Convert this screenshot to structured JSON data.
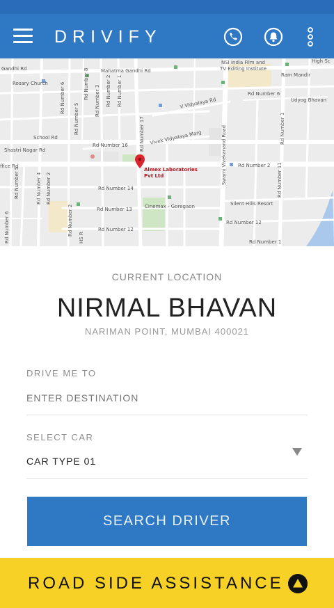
{
  "app": {
    "title": "DRIVIFY"
  },
  "map": {
    "pin_label_line1": "Almex Laboratories",
    "pin_label_line2": "Pvt Ltd",
    "labels": {
      "gandhi_rd": "Gandhi Rd",
      "mahatma_gandhi_rd": "Mahatma Gandhi Rd",
      "nsi_india": "NSI India Film and",
      "tv_editing": "TV Editing Institute",
      "ram_mandir": "Ram Mandir",
      "high_sc": "High Sc",
      "rosary_church": "Rosary Church",
      "rd_number_6_right": "Rd Number 6",
      "udyog_bhavan": "Udyog Bhavan",
      "v_vidyalaya_rd": "V Vidyalaya Rd",
      "school_rd": "School Rd",
      "rd_number_16": "Rd Number 16",
      "vivek_vidyalaya_marg": "Vivek Vidyalaya Marg",
      "shastri_nagar_rd": "Shastri Nagar Rd",
      "office_rd": "ffice Rd",
      "rd_number_2_right": "Rd Number 2",
      "rd_number_14": "Rd Number 14",
      "cinemax_goregaon": "Cinemax - Goregaon",
      "silent_hills_resort": "Silent Hills Resort",
      "rd_number_13": "Rd Number 13",
      "rd_number_12_right": "Rd Number 12",
      "rd_number_12": "Rd Number 12",
      "rd_number_1_bottom": "Rd Number 1",
      "swami_vivekanand_road": "Swami Vivekanand Road",
      "rd_number_17": "Rd Number 17",
      "rd_number_1_v": "Rd Number 1",
      "rd_number_11": "Rd Number 11",
      "rd_number_3": "Rd Number 3",
      "rd_number_2_v": "Rd Number 2",
      "rd_number_1_left": "Rd Number 1",
      "rd_number_6_v": "Rd Number 6",
      "rd_number_5_v": "Rd Number 5",
      "rd_number_8": "Rd Number 8",
      "rd_number_5_left": "Rd Number 5",
      "rd_number_2_left": "Rd Number 2",
      "rd_number_4": "Rd Number 4",
      "rd_number_6_bl": "Rd Number 6",
      "rd_number_2_b": "Rd Number 2",
      "hs_rd": "HS R"
    }
  },
  "current_location": {
    "caption": "CURRENT LOCATION",
    "name": "NIRMAL BHAVAN",
    "address": "NARIMAN POINT, MUMBAI 400021"
  },
  "destination": {
    "label": "DRIVE ME TO",
    "placeholder": "ENTER DESTINATION"
  },
  "car": {
    "label": "SELECT CAR",
    "selected": "CAR TYPE 01"
  },
  "actions": {
    "search_label": "SEARCH DRIVER",
    "assist_label": "ROAD SIDE ASSISTANCE"
  },
  "colors": {
    "primary": "#2f78c4",
    "status_bar": "#2a6cb8",
    "accent_yellow": "#f8d126",
    "pin_red": "#d9262e"
  },
  "icons": {
    "menu": "hamburger-menu-icon",
    "phone": "phone-icon",
    "notifications": "bell-icon",
    "more": "more-vertical-icon",
    "pin": "map-pin-icon",
    "dropdown": "dropdown-caret-icon",
    "assist": "warning-triangle-icon"
  }
}
